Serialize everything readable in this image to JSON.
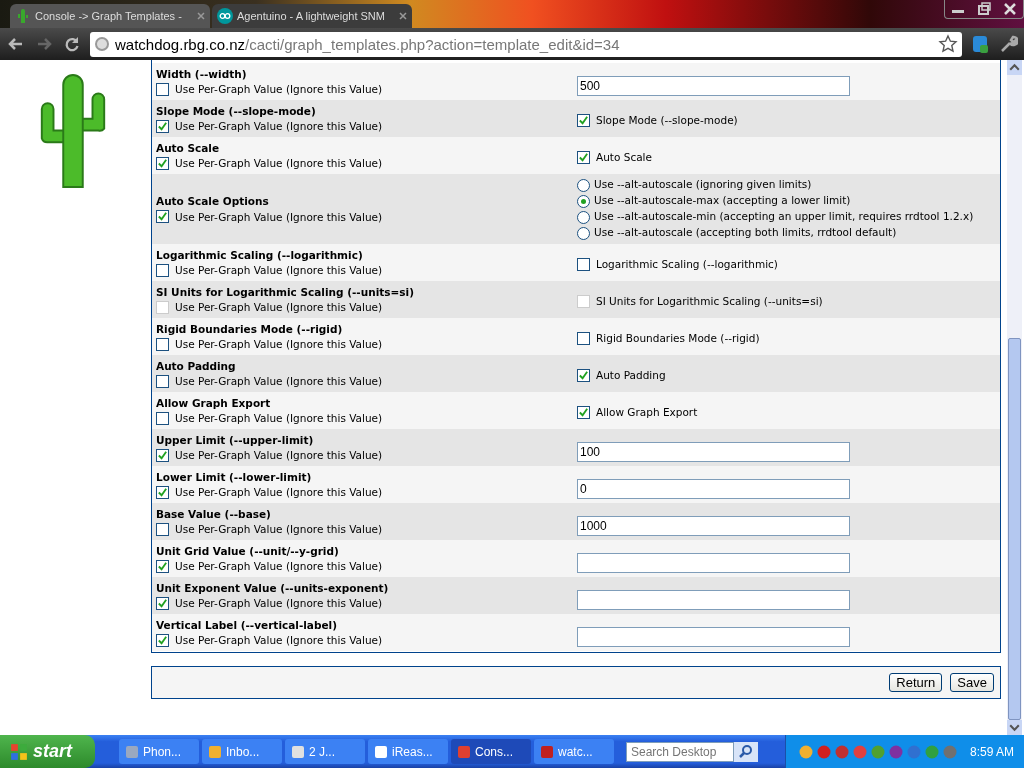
{
  "browser": {
    "tabs": [
      {
        "title": "Console -> Graph Templates -",
        "selected": true
      },
      {
        "title": "Agentuino - A lightweight SNM",
        "selected": false
      }
    ],
    "url_host": "watchdog.rbg.co.nz",
    "url_path": "/cacti/graph_templates.php?action=template_edit&id=34"
  },
  "rows": [
    {
      "title": "Width (--width)",
      "override_label": "Use Per-Graph Value (Ignore this Value)",
      "override_checked": false,
      "disabled": false,
      "kind": "text",
      "value": "500"
    },
    {
      "title": "Slope Mode (--slope-mode)",
      "override_label": "Use Per-Graph Value (Ignore this Value)",
      "override_checked": true,
      "disabled": false,
      "kind": "checkbox",
      "label": "Slope Mode (--slope-mode)",
      "checked": true
    },
    {
      "title": "Auto Scale",
      "override_label": "Use Per-Graph Value (Ignore this Value)",
      "override_checked": true,
      "disabled": false,
      "kind": "checkbox",
      "label": "Auto Scale",
      "checked": true
    },
    {
      "title": "Auto Scale Options",
      "override_label": "Use Per-Graph Value (Ignore this Value)",
      "override_checked": true,
      "disabled": false,
      "kind": "radio",
      "options": [
        {
          "label": "Use --alt-autoscale (ignoring given limits)",
          "selected": false
        },
        {
          "label": "Use --alt-autoscale-max (accepting a lower limit)",
          "selected": true
        },
        {
          "label": "Use --alt-autoscale-min (accepting an upper limit, requires rrdtool 1.2.x)",
          "selected": false
        },
        {
          "label": "Use --alt-autoscale (accepting both limits, rrdtool default)",
          "selected": false
        }
      ]
    },
    {
      "title": "Logarithmic Scaling (--logarithmic)",
      "override_label": "Use Per-Graph Value (Ignore this Value)",
      "override_checked": false,
      "disabled": false,
      "kind": "checkbox",
      "label": "Logarithmic Scaling (--logarithmic)",
      "checked": false
    },
    {
      "title": "SI Units for Logarithmic Scaling (--units=si)",
      "override_label": "Use Per-Graph Value (Ignore this Value)",
      "override_checked": false,
      "disabled": true,
      "kind": "checkbox",
      "label": "SI Units for Logarithmic Scaling (--units=si)",
      "checked": false
    },
    {
      "title": "Rigid Boundaries Mode (--rigid)",
      "override_label": "Use Per-Graph Value (Ignore this Value)",
      "override_checked": false,
      "disabled": false,
      "kind": "checkbox",
      "label": "Rigid Boundaries Mode (--rigid)",
      "checked": false
    },
    {
      "title": "Auto Padding",
      "override_label": "Use Per-Graph Value (Ignore this Value)",
      "override_checked": false,
      "disabled": false,
      "kind": "checkbox",
      "label": "Auto Padding",
      "checked": true
    },
    {
      "title": "Allow Graph Export",
      "override_label": "Use Per-Graph Value (Ignore this Value)",
      "override_checked": false,
      "disabled": false,
      "kind": "checkbox",
      "label": "Allow Graph Export",
      "checked": true
    },
    {
      "title": "Upper Limit (--upper-limit)",
      "override_label": "Use Per-Graph Value (Ignore this Value)",
      "override_checked": true,
      "disabled": false,
      "kind": "text",
      "value": "100"
    },
    {
      "title": "Lower Limit (--lower-limit)",
      "override_label": "Use Per-Graph Value (Ignore this Value)",
      "override_checked": true,
      "disabled": false,
      "kind": "text",
      "value": "0"
    },
    {
      "title": "Base Value (--base)",
      "override_label": "Use Per-Graph Value (Ignore this Value)",
      "override_checked": false,
      "disabled": false,
      "kind": "text",
      "value": "1000"
    },
    {
      "title": "Unit Grid Value (--unit/--y-grid)",
      "override_label": "Use Per-Graph Value (Ignore this Value)",
      "override_checked": true,
      "disabled": false,
      "kind": "text"
    },
    {
      "title": "Unit Exponent Value (--units-exponent)",
      "override_label": "Use Per-Graph Value (Ignore this Value)",
      "override_checked": true,
      "disabled": false,
      "kind": "text"
    },
    {
      "title": "Vertical Label (--vertical-label)",
      "override_label": "Use Per-Graph Value (Ignore this Value)",
      "override_checked": true,
      "disabled": false,
      "kind": "text"
    }
  ],
  "buttons": [
    "Return",
    "Save"
  ],
  "taskbar": {
    "start": "start",
    "tasks": [
      {
        "label": "Phon...",
        "selected": false
      },
      {
        "label": "Inbo...",
        "selected": false
      },
      {
        "label": "2 J...",
        "selected": false
      },
      {
        "label": "iReas...",
        "selected": false
      },
      {
        "label": "Cons...",
        "selected": true
      },
      {
        "label": "watc...",
        "selected": false
      }
    ],
    "search_placeholder": "Search Desktop",
    "clock": "8:59 AM"
  }
}
